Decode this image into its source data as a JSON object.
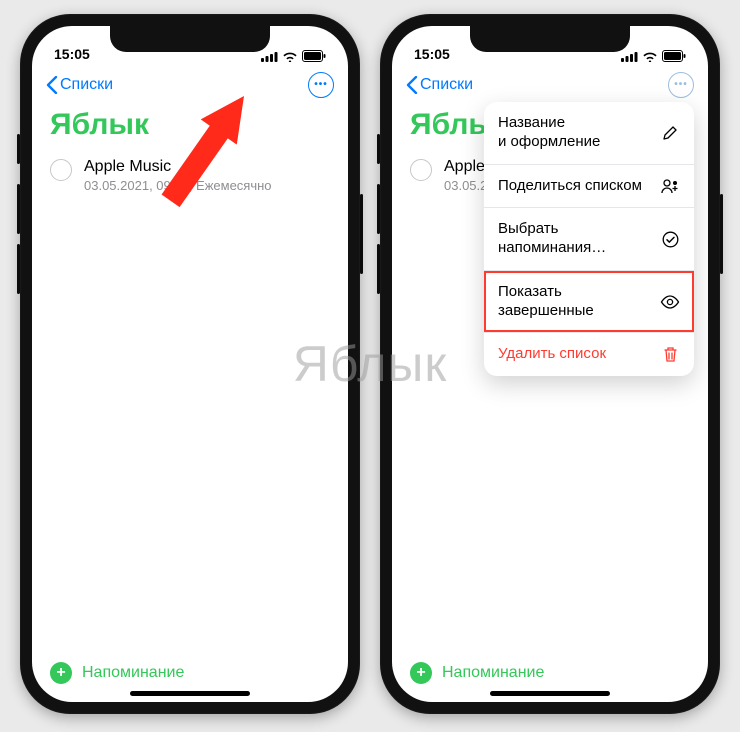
{
  "statusbar": {
    "time": "15:05"
  },
  "navbar": {
    "back_label": "Списки"
  },
  "list": {
    "title": "Яблык",
    "reminder": {
      "title": "Apple Music",
      "subtitle_full": "03.05.2021, 09:00, Ежемесячно",
      "subtitle_trunc": "03.05.2021, 09"
    }
  },
  "footer": {
    "add_label": "Напоминание"
  },
  "menu": {
    "items": [
      {
        "label": "Название\nи оформление",
        "icon": "pencil"
      },
      {
        "label": "Поделиться списком",
        "icon": "share"
      },
      {
        "label": "Выбрать\nнапоминания…",
        "icon": "check"
      },
      {
        "label": "Показать завершенные",
        "icon": "eye",
        "highlight": true
      },
      {
        "label": "Удалить список",
        "icon": "trash",
        "danger": true
      }
    ]
  },
  "watermark": "Яблык"
}
